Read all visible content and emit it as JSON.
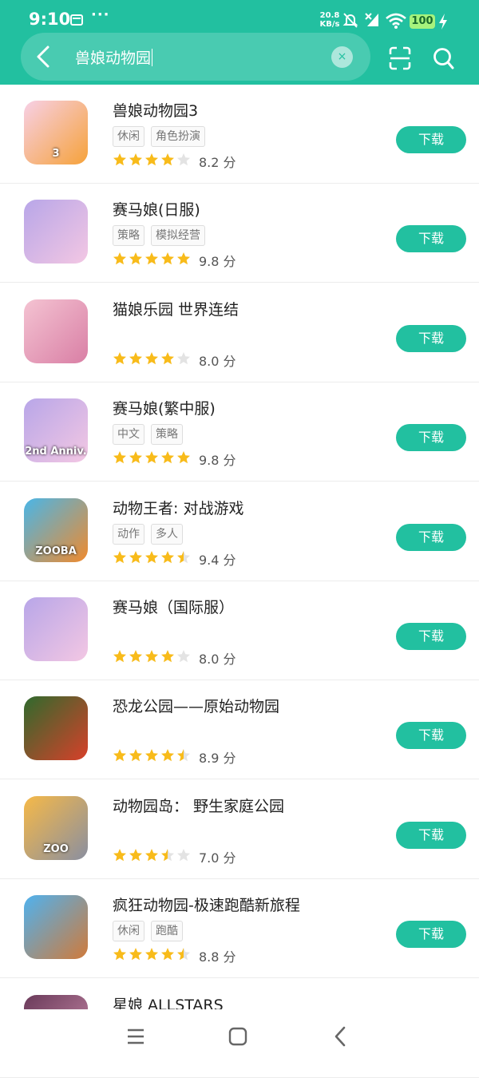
{
  "status_bar": {
    "time": "9:10",
    "more": "···",
    "speed_value": "20.8",
    "speed_unit": "KB/s",
    "battery": "100"
  },
  "search": {
    "query": "兽娘动物园",
    "clear_symbol": "×"
  },
  "download_label": "下载",
  "score_unit": "分",
  "colors": {
    "accent": "#22c0a0",
    "star_on": "#f8bb1a",
    "star_off": "#e3e3e3",
    "battery": "#a6f37d"
  },
  "apps": [
    {
      "title": "兽娘动物园3",
      "tags": [
        "休闲",
        "角色扮演"
      ],
      "stars": 4,
      "score": "8.2",
      "icon_colors": [
        "#f7d0e6",
        "#f6a23a"
      ],
      "icon_badge": "3"
    },
    {
      "title": "赛马娘(日服)",
      "tags": [
        "策略",
        "模拟经营"
      ],
      "stars": 5,
      "score": "9.8",
      "icon_colors": [
        "#b8a6e8",
        "#f3c7e3"
      ],
      "icon_badge": ""
    },
    {
      "title": "猫娘乐园 世界连结",
      "tags": [],
      "stars": 4,
      "score": "8.0",
      "icon_colors": [
        "#f4c3d2",
        "#d97fa5"
      ],
      "icon_badge": ""
    },
    {
      "title": "赛马娘(繁中服)",
      "tags": [
        "中文",
        "策略"
      ],
      "stars": 5,
      "score": "9.8",
      "icon_colors": [
        "#b8a6e8",
        "#f3c7e3"
      ],
      "icon_badge": "2nd Anniv."
    },
    {
      "title": "动物王者: 对战游戏",
      "tags": [
        "动作",
        "多人"
      ],
      "stars": 4.5,
      "score": "9.4",
      "icon_colors": [
        "#49b6e8",
        "#f08a2d"
      ],
      "icon_badge": "ZOOBA"
    },
    {
      "title": "赛马娘（国际服）",
      "tags": [],
      "stars": 4,
      "score": "8.0",
      "icon_colors": [
        "#b8a6e8",
        "#f3c7e3"
      ],
      "icon_badge": ""
    },
    {
      "title": "恐龙公园——原始动物园",
      "tags": [],
      "stars": 4.5,
      "score": "8.9",
      "icon_colors": [
        "#2f6a2d",
        "#d8402a"
      ],
      "icon_badge": ""
    },
    {
      "title": "动物园岛： 野生家庭公园",
      "tags": [],
      "stars": 3.5,
      "score": "7.0",
      "icon_colors": [
        "#f6b948",
        "#8a8fa0"
      ],
      "icon_badge": "ZOO"
    },
    {
      "title": "疯狂动物园-极速跑酷新旅程",
      "tags": [
        "休闲",
        "跑酷"
      ],
      "stars": 4.5,
      "score": "8.8",
      "icon_colors": [
        "#4fb2ef",
        "#d07a3a"
      ],
      "icon_badge": ""
    },
    {
      "title": "星娘 ALLSTARS",
      "tags": [],
      "stars": 0,
      "score": "",
      "icon_colors": [
        "#6a3a5a",
        "#c98aa8"
      ],
      "icon_badge": ""
    }
  ]
}
